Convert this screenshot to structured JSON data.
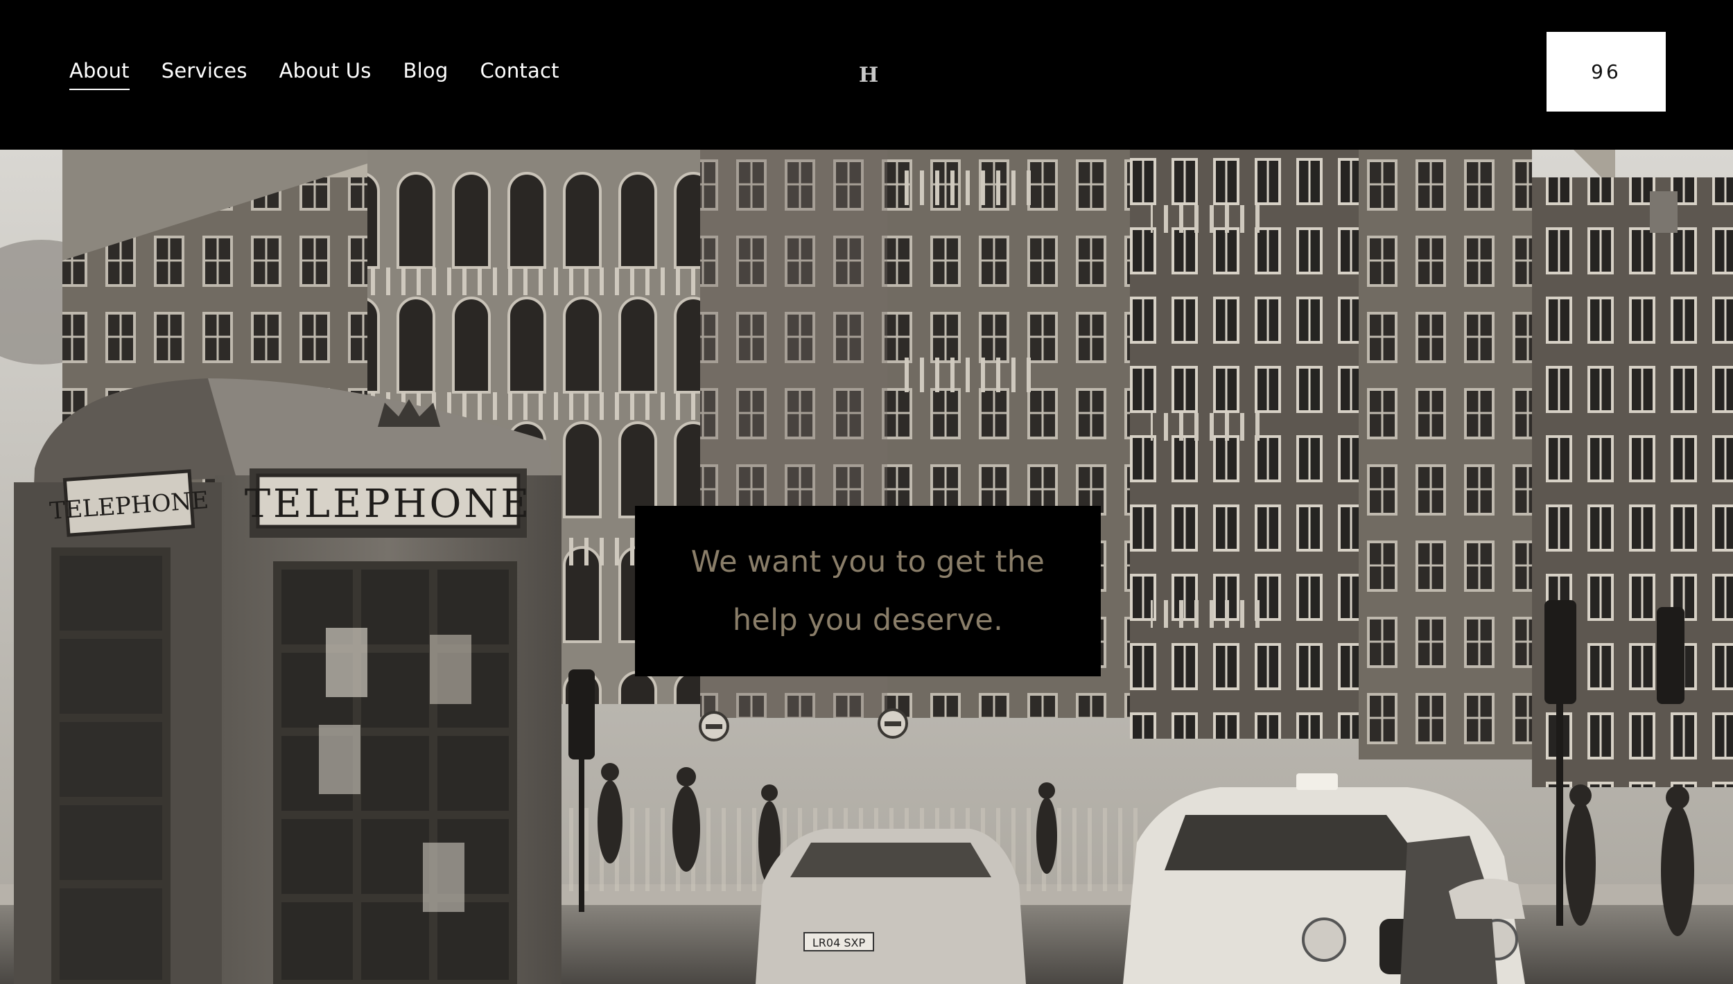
{
  "header": {
    "nav": [
      {
        "label": "About",
        "active": true
      },
      {
        "label": "Services",
        "active": false
      },
      {
        "label": "About Us",
        "active": false
      },
      {
        "label": "Blog",
        "active": false
      },
      {
        "label": "Contact",
        "active": false
      }
    ],
    "logo_text": "H",
    "cart_label": "96"
  },
  "hero": {
    "image": "sepia street scene with red telephone box, victorian buildings and taxi",
    "telephone_sign": "TELEPHONE",
    "taxi_plate": "LR04 SXP",
    "tagline": "We want you to get the help you deserve."
  },
  "colors": {
    "header_bg": "#000000",
    "tagline_text": "#8a7e69",
    "cart_bg": "#ffffff"
  }
}
